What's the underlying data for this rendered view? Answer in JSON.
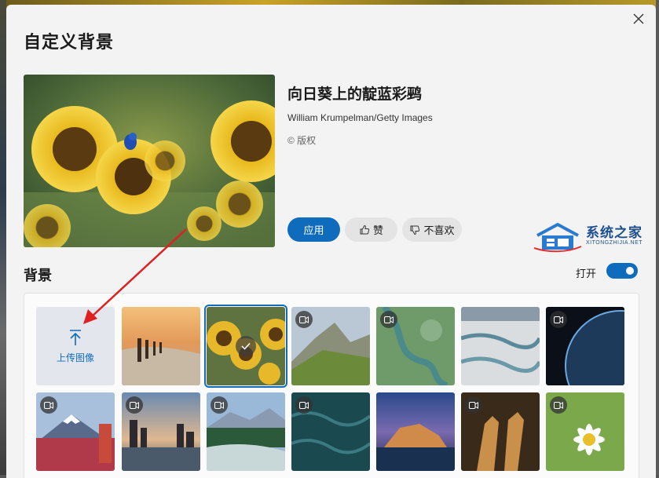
{
  "dialog": {
    "title": "自定义背景"
  },
  "current": {
    "title": "向日葵上的靛蓝彩鹀",
    "credit": "William Krumpelman/Getty Images",
    "copyright": "© 版权"
  },
  "actions": {
    "apply": "应用",
    "like": "赞",
    "dislike": "不喜欢"
  },
  "watermark": {
    "brand": "系统之家",
    "url": "XITONGZHIJIA.NET"
  },
  "gallery": {
    "section_title": "背景",
    "toggle_label": "打开",
    "toggle_on": true,
    "upload_label": "上传图像"
  },
  "colors": {
    "accent": "#0f6cbd",
    "arrow": "#e02020"
  }
}
